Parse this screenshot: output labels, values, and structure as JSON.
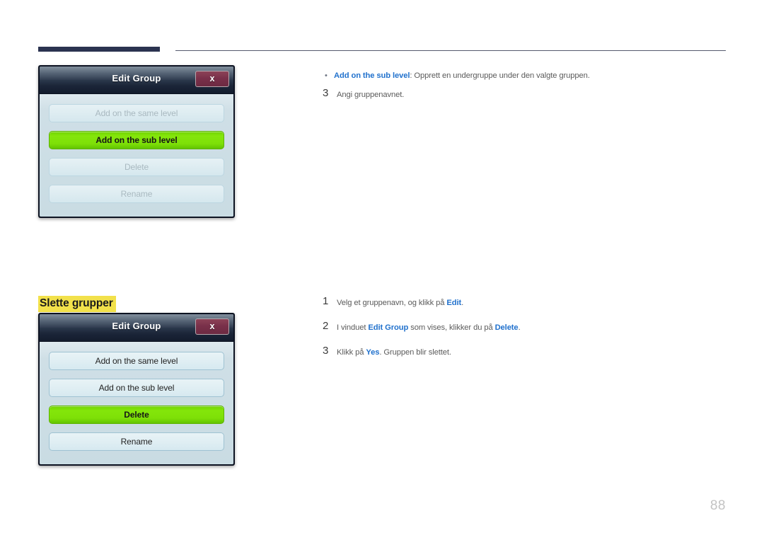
{
  "page": {
    "number": "88",
    "section_heading": "Slette grupper"
  },
  "dialog_top": {
    "title": "Edit Group",
    "close_label": "x",
    "buttons": [
      {
        "label": "Add on the same level",
        "state": "disabled"
      },
      {
        "label": "Add on the sub level",
        "state": "selected"
      },
      {
        "label": "Delete",
        "state": "disabled"
      },
      {
        "label": "Rename",
        "state": "disabled"
      }
    ]
  },
  "dialog_bottom": {
    "title": "Edit Group",
    "close_label": "x",
    "buttons": [
      {
        "label": "Add on the same level",
        "state": "enabled"
      },
      {
        "label": "Add on the sub level",
        "state": "enabled"
      },
      {
        "label": "Delete",
        "state": "selected"
      },
      {
        "label": "Rename",
        "state": "enabled"
      }
    ]
  },
  "content_top": {
    "bullet": {
      "marker": "•",
      "link": "Add on the sub level",
      "rest": ": Opprett en undergruppe under den valgte gruppen."
    },
    "step": {
      "number": "3",
      "text": "Angi gruppenavnet."
    }
  },
  "content_bottom": {
    "steps": [
      {
        "number": "1",
        "pre": "Velg et gruppenavn, og klikk på ",
        "link1": "Edit",
        "mid": "",
        "link2": "",
        "post": "."
      },
      {
        "number": "2",
        "pre": "I vinduet ",
        "link1": "Edit Group",
        "mid": " som vises, klikker du på ",
        "link2": "Delete",
        "post": "."
      },
      {
        "number": "3",
        "pre": "Klikk på ",
        "link1": "Yes",
        "mid": ". Gruppen blir slettet.",
        "link2": "",
        "post": ""
      }
    ]
  },
  "colors": {
    "accent_blue": "#2272cd",
    "highlight_yellow": "#f2e14b",
    "selected_green": "#7ee008",
    "rule_navy": "#2b3350",
    "close_maroon": "#79304a"
  }
}
